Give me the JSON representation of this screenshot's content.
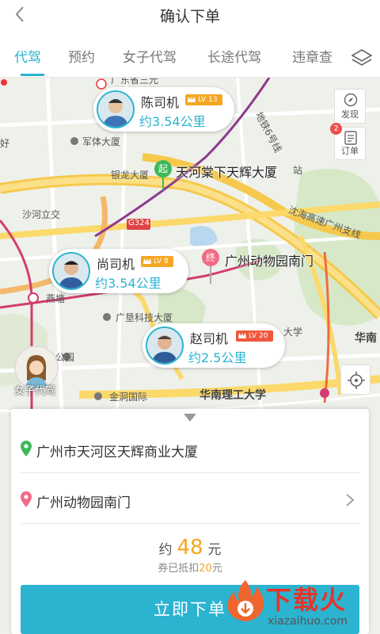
{
  "header": {
    "title": "确认下单"
  },
  "tabs": [
    {
      "label": "代驾",
      "active": true
    },
    {
      "label": "预约"
    },
    {
      "label": "女子代驾"
    },
    {
      "label": "长途代驾"
    },
    {
      "label": "违章查"
    }
  ],
  "map": {
    "labels": [
      "军体大厦",
      "银龙大厦",
      "沙河立交",
      "G324",
      "燕塘",
      "广垦科技大厦",
      "金洞国际",
      "公园",
      "华南理工大学",
      "华南",
      "大学",
      "站",
      "好",
      "沈海高速广州支线",
      "地铁6号线",
      "广东省三元"
    ],
    "buttons": {
      "discover": "发现",
      "orders": "订单",
      "order_badge": "2"
    },
    "female_driver_label": "女子代驾",
    "start_marker": {
      "tag": "起",
      "name": "天河棠下天辉大厦"
    },
    "end_marker": {
      "tag": "终",
      "name": "广州动物园南门"
    }
  },
  "drivers": [
    {
      "name": "陈司机",
      "level": "LV 13",
      "distance": "约3.54公里"
    },
    {
      "name": "尚司机",
      "level": "LV 8",
      "distance": "约3.54公里"
    },
    {
      "name": "赵司机",
      "level": "LV 20",
      "distance": "约2.5公里"
    }
  ],
  "panel": {
    "start_address": "广州市天河区天辉商业大厦",
    "end_address": "广州动物园南门",
    "price_prefix": "约",
    "price_amount": "48",
    "price_unit": "元",
    "coupon_prefix": "券已抵扣",
    "coupon_amount": "20",
    "coupon_unit": "元",
    "order_button": "立即下单"
  },
  "watermark": {
    "title": "下载火",
    "subtitle": "xiazaihuo.com"
  },
  "colors": {
    "accent": "#2bb3d0",
    "price": "#f5a623",
    "end_marker": "#f06b86",
    "start_marker": "#3cb95b"
  }
}
